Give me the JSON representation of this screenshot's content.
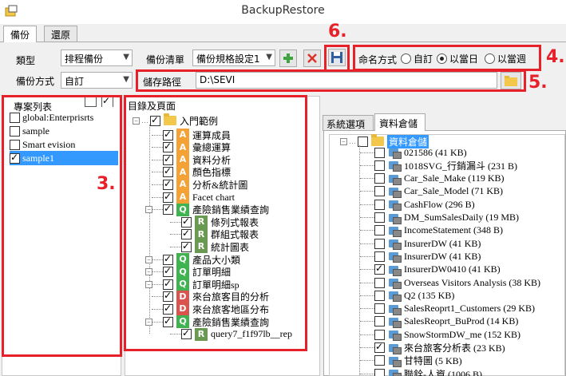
{
  "window": {
    "title": "BackupRestore"
  },
  "tabs": [
    "備份",
    "還原"
  ],
  "form": {
    "type_label": "類型",
    "type_value": "排程備份",
    "list_label": "備份清單",
    "list_value": "備份規格設定1",
    "method_label": "備份方式",
    "method_value": "自訂",
    "path_label": "儲存路徑",
    "path_value": "D:\\SEVI"
  },
  "naming": {
    "label": "命名方式",
    "options": [
      "自訂",
      "以當日",
      "以當週"
    ],
    "selected": "以當日"
  },
  "annotations": [
    "6.",
    "4.",
    "5.",
    "3."
  ],
  "projects": {
    "header": "專案列表",
    "items": [
      {
        "label": "global:Enterprisrts",
        "checked": false,
        "selected": false
      },
      {
        "label": "sample",
        "checked": false,
        "selected": false
      },
      {
        "label": "Smart evision",
        "checked": false,
        "selected": false
      },
      {
        "label": "sample1",
        "checked": true,
        "selected": true
      }
    ]
  },
  "catalog": {
    "header": "目錄及頁面",
    "root": "入門範例",
    "items": [
      {
        "icon": "A",
        "label": "運算成員",
        "checked": true
      },
      {
        "icon": "A",
        "label": "彙總運算",
        "checked": true
      },
      {
        "icon": "A",
        "label": "資料分析",
        "checked": true
      },
      {
        "icon": "A",
        "label": "顏色指標",
        "checked": true
      },
      {
        "icon": "A",
        "label": "分析&統計圖",
        "checked": true
      },
      {
        "icon": "A",
        "label": "Facet chart",
        "checked": true
      },
      {
        "icon": "Q",
        "label": "產險銷售業績查詢",
        "checked": true
      },
      {
        "icon": "R",
        "label": "條列式報表",
        "checked": true
      },
      {
        "icon": "R",
        "label": "群組式報表",
        "checked": true
      },
      {
        "icon": "R",
        "label": "統計圖表",
        "checked": true
      },
      {
        "icon": "Q",
        "label": "產品大小類",
        "checked": true
      },
      {
        "icon": "Q",
        "label": "訂單明細",
        "checked": true
      },
      {
        "icon": "Q",
        "label": "訂單明細sp",
        "checked": true
      },
      {
        "icon": "D",
        "label": "來台旅客目的分析",
        "checked": true
      },
      {
        "icon": "D",
        "label": "來台旅客地區分布",
        "checked": true
      },
      {
        "icon": "Q",
        "label": "產險銷售業績查詢",
        "checked": true
      },
      {
        "icon": "R",
        "label": "query7_f1f97lb__rep",
        "checked": true
      }
    ]
  },
  "right_tabs": [
    "系統選項",
    "資料倉儲"
  ],
  "warehouse": {
    "root": "資料倉儲",
    "items": [
      {
        "label": "021586 (41 KB)",
        "checked": false
      },
      {
        "label": "1018SVG_行銷漏斗 (231 B)",
        "checked": false
      },
      {
        "label": "Car_Sale_Make (119 KB)",
        "checked": false
      },
      {
        "label": "Car_Sale_Model (71 KB)",
        "checked": false
      },
      {
        "label": "CashFlow (296 B)",
        "checked": false
      },
      {
        "label": "DM_SumSalesDaily (19 MB)",
        "checked": false
      },
      {
        "label": "IncomeStatement (348 B)",
        "checked": false
      },
      {
        "label": "InsurerDW (41 KB)",
        "checked": false
      },
      {
        "label": "InsurerDW (41 KB)",
        "checked": false
      },
      {
        "label": "InsurerDW0410 (41 KB)",
        "checked": true
      },
      {
        "label": "Overseas Visitors Analysis (38 KB)",
        "checked": false
      },
      {
        "label": "Q2 (135 KB)",
        "checked": false
      },
      {
        "label": "SalesReoprt1_Customers (29 KB)",
        "checked": false
      },
      {
        "label": "SalesReoprt_BuProd (14 KB)",
        "checked": false
      },
      {
        "label": "SnowStormDW_me (152 KB)",
        "checked": false
      },
      {
        "label": "來台旅客分析表 (23 KB)",
        "checked": true
      },
      {
        "label": "甘特圖 (5 KB)",
        "checked": false
      },
      {
        "label": "聯銓-人資 (1006 B)",
        "checked": false
      }
    ]
  },
  "colors": {
    "annotation_red": "#e8202a",
    "selection_blue": "#3399ff"
  }
}
